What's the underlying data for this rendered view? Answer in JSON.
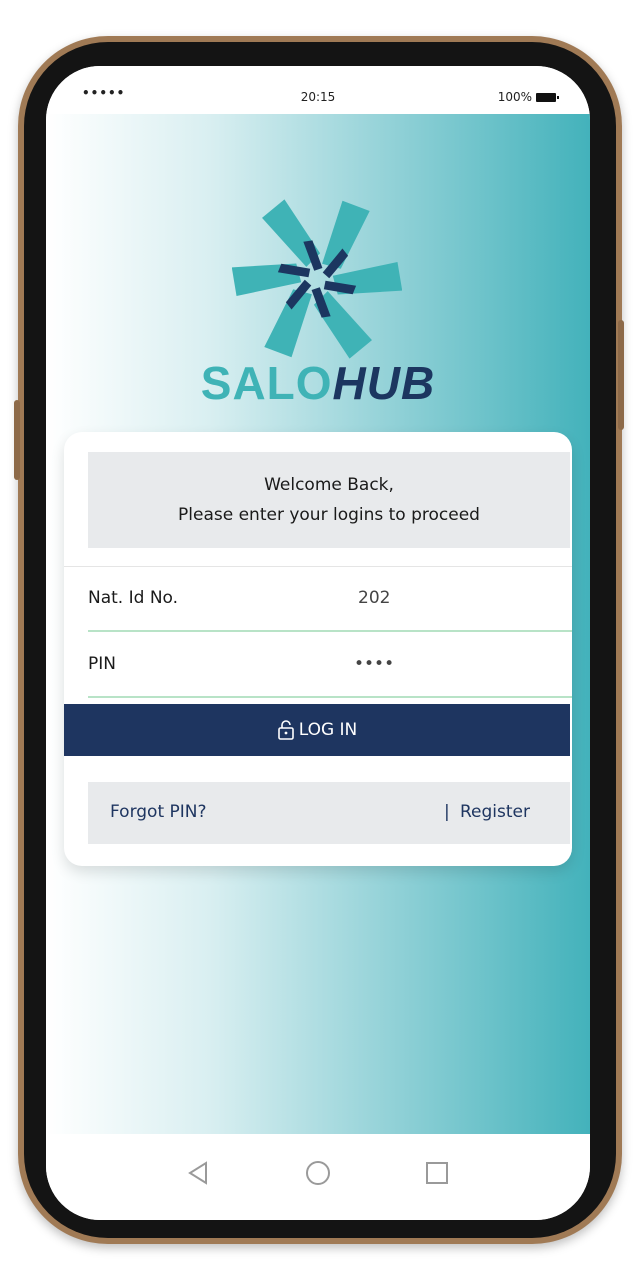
{
  "status_bar": {
    "signal": "•••••",
    "time": "20:15",
    "battery": "100%"
  },
  "brand": {
    "part1": "SALO",
    "part2": "HUB",
    "color_teal": "#3fb3b6",
    "color_navy": "#1c3660"
  },
  "login_card": {
    "welcome_line1": "Welcome Back,",
    "welcome_line2": "Please enter your logins to proceed",
    "fields": [
      {
        "label": "Nat. Id No.",
        "value": "202"
      },
      {
        "label": "PIN",
        "value": "••••"
      }
    ],
    "login_label": "LOG IN",
    "forgot_label": "Forgot PIN?",
    "separator": "|",
    "register_label": "Register",
    "accent_color": "#1e3560"
  },
  "nav_icons": [
    "back-triangle-icon",
    "home-circle-icon",
    "recents-square-icon"
  ]
}
